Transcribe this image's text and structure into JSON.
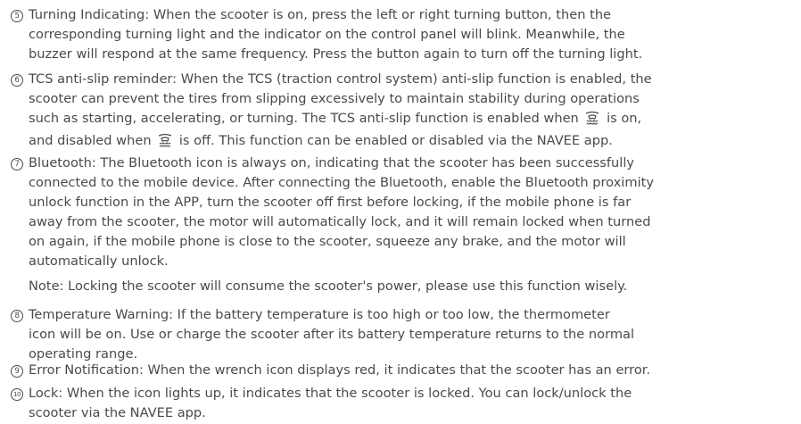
{
  "items": [
    {
      "marker": "5",
      "lines": [
        "Turning Indicating: When the scooter is on, press the left or right turning button, then the",
        "corresponding turning light and the indicator on the control panel will blink. Meanwhile, the",
        "buzzer will respond at the same frequency. Press the button again to turn off the turning light."
      ]
    },
    {
      "marker": "6",
      "lines": [
        "TCS anti-slip reminder: When the TCS (traction control system) anti-slip function is enabled, the",
        "scooter can prevent the tires from slipping excessively to maintain stability during operations",
        "such as starting, accelerating, or turning. The TCS anti-slip function is enabled when",
        "is on,",
        "and disabled when",
        "is off. This function can be enabled or disabled via the NAVEE app."
      ]
    },
    {
      "marker": "7",
      "lines": [
        "Bluetooth: The Bluetooth icon is always on, indicating that the scooter has been successfully",
        "connected to the mobile device. After connecting the Bluetooth, enable the Bluetooth proximity",
        "unlock function in the APP, turn the scooter off first before locking, if the mobile phone is far",
        "away from the scooter, the motor will automatically lock, and it will remain locked when turned",
        "on again, if the mobile phone is close to the scooter, squeeze any brake, and the motor will",
        "automatically unlock."
      ]
    },
    {
      "marker": "8",
      "lines": [
        "Temperature Warning: If the battery temperature is too high or too low, the thermometer",
        "icon will be on. Use or charge the scooter after its battery temperature returns to the normal",
        "operating range."
      ]
    },
    {
      "marker": "9",
      "lines": [
        "Error Notification: When the wrench icon displays red, it indicates that the scooter has an error."
      ]
    },
    {
      "marker": "10",
      "lines": [
        "Lock: When the icon lights up, it indicates that the scooter is locked. You can lock/unlock the",
        "scooter via the NAVEE app."
      ]
    }
  ],
  "note": "Note: Locking the scooter will consume the scooter's power, please use this function wisely.",
  "icons": {
    "tcs": "tcs-icon"
  }
}
